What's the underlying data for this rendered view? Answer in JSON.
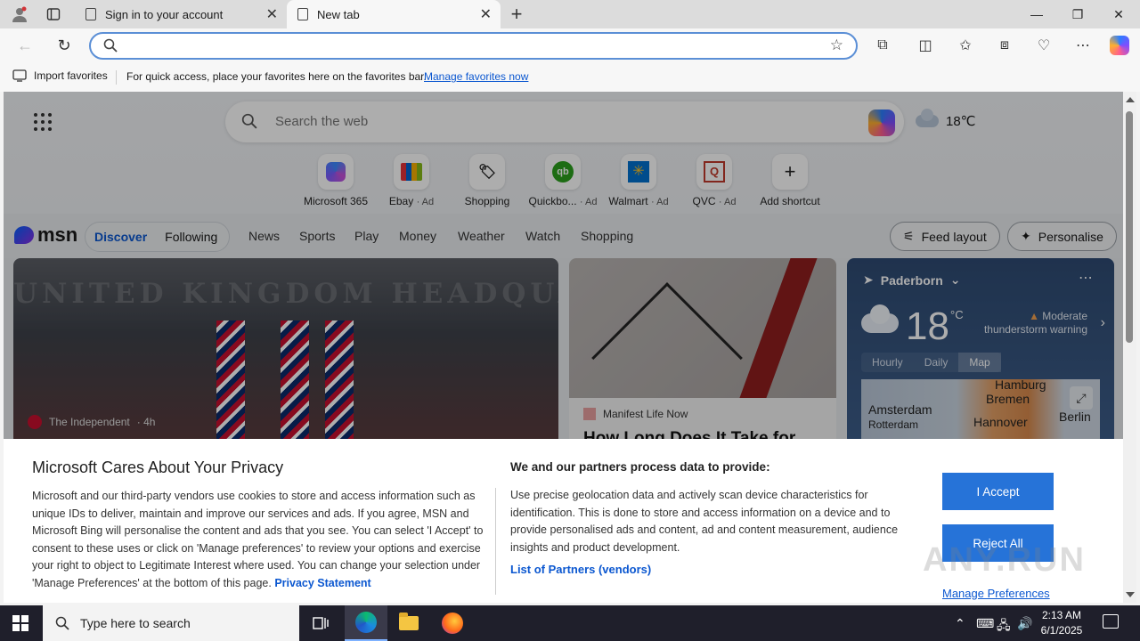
{
  "browser": {
    "tabs": [
      {
        "label": "Sign in to your account"
      },
      {
        "label": "New tab"
      }
    ],
    "address": {
      "value": "",
      "placeholder": ""
    },
    "favorites_bar": {
      "import_label": "Import favorites",
      "message": "For quick access, place your favorites here on the favorites bar.",
      "manage_link": "Manage favorites now"
    }
  },
  "newtab": {
    "search_placeholder": "Search the web",
    "weather_mini": "18℃",
    "shortcuts": [
      {
        "label": "Microsoft 365",
        "ad": ""
      },
      {
        "label": "Ebay",
        "ad": "· Ad"
      },
      {
        "label": "Shopping",
        "ad": ""
      },
      {
        "label": "Quickbo...",
        "ad": "· Ad"
      },
      {
        "label": "Walmart",
        "ad": "· Ad"
      },
      {
        "label": "QVC",
        "ad": "· Ad"
      },
      {
        "label": "Add shortcut",
        "ad": ""
      }
    ],
    "msn": {
      "logo": "msn",
      "pills": [
        "Discover",
        "Following"
      ],
      "nav": [
        "News",
        "Sports",
        "Play",
        "Money",
        "Weather",
        "Watch",
        "Shopping"
      ],
      "feed_layout": "Feed layout",
      "personalise": "Personalise"
    },
    "cards": {
      "card1": {
        "sign_text": "UNITED KINGDOM HEADQUARTERS",
        "source": "The Independent",
        "age": "· 4h"
      },
      "card2": {
        "source": "Manifest Life Now",
        "headline": "How Long Does It Take for"
      }
    },
    "weather_card": {
      "location": "Paderborn",
      "temp": "18",
      "unit": "°C",
      "warning": "Moderate thunderstorm warning",
      "tabs": [
        "Hourly",
        "Daily",
        "Map"
      ],
      "map_labels": [
        "Hamburg",
        "Bremen",
        "Amsterdam",
        "Hannover",
        "Rotterdam",
        "Berlin"
      ]
    }
  },
  "privacy": {
    "title": "Microsoft Cares About Your Privacy",
    "body": "Microsoft and our third-party vendors use cookies to store and access information such as unique IDs to deliver, maintain and improve our services and ads. If you agree, MSN and Microsoft Bing will personalise the content and ads that you see. You can select 'I Accept' to consent to these uses or click on 'Manage preferences' to review your options and exercise your right to object to Legitimate Interest where used.  You can change your selection under 'Manage Preferences' at the bottom of this page.",
    "privacy_link": "Privacy Statement",
    "data_title": "We and our partners process data to provide:",
    "data_body": "Use precise geolocation data and actively scan device characteristics for identification. This is done to store and access information on a device and to provide personalised ads and content, ad and content measurement, audience insights and product development.",
    "partners_link": "List of Partners (vendors)",
    "accept": "I Accept",
    "reject": "Reject All",
    "manage": "Manage Preferences"
  },
  "watermark": "ANY.RUN",
  "taskbar": {
    "search_placeholder": "Type here to search",
    "time": "2:13 AM",
    "date": "6/1/2025"
  },
  "colors": {
    "accent": "#2673d8",
    "link": "#0b57d0",
    "address_focus": "#5b8fd6"
  }
}
